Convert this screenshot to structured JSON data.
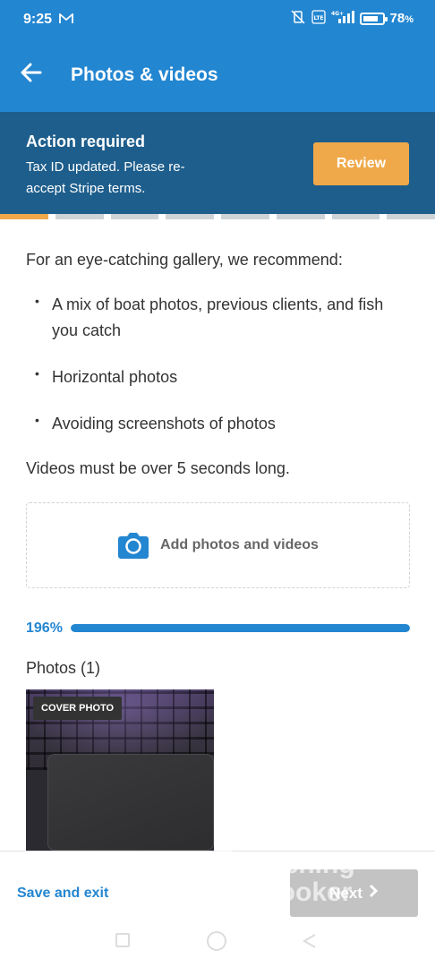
{
  "status_bar": {
    "time": "9:25",
    "mail_icon": "gmail-icon",
    "battery": "78",
    "battery_unit": "%",
    "network": "4G+"
  },
  "app_bar": {
    "back_icon": "back-arrow-icon",
    "title": "Photos & videos"
  },
  "banner": {
    "title": "Action required",
    "text": "Tax ID updated. Please re-accept Stripe terms.",
    "review_label": "Review"
  },
  "steps": {
    "total": 8,
    "active_index": 0
  },
  "content": {
    "intro": "For an eye-catching gallery, we recommend:",
    "bullets": [
      "A mix of boat photos, previous clients, and fish you catch",
      "Horizontal photos",
      "Avoiding screenshots of photos"
    ],
    "videos_note": "Videos must be over 5 seconds long.",
    "upload_label": "Add photos and videos",
    "upload_icon": "camera-icon",
    "progress": {
      "label": "196%",
      "fill_fraction": 1.0
    },
    "photos_heading": "Photos (1)",
    "cover_badge": "COVER PHOTO"
  },
  "footer": {
    "save_exit_label": "Save and exit",
    "next_label": "Next",
    "next_icon": "chevron-right-icon",
    "watermark_line1": "Fishing",
    "watermark_line2": "Booker"
  },
  "colors": {
    "primary": "#2386d1",
    "banner": "#1e5e8c",
    "accent": "#f0a94a",
    "disabled": "#c3c3c3"
  }
}
